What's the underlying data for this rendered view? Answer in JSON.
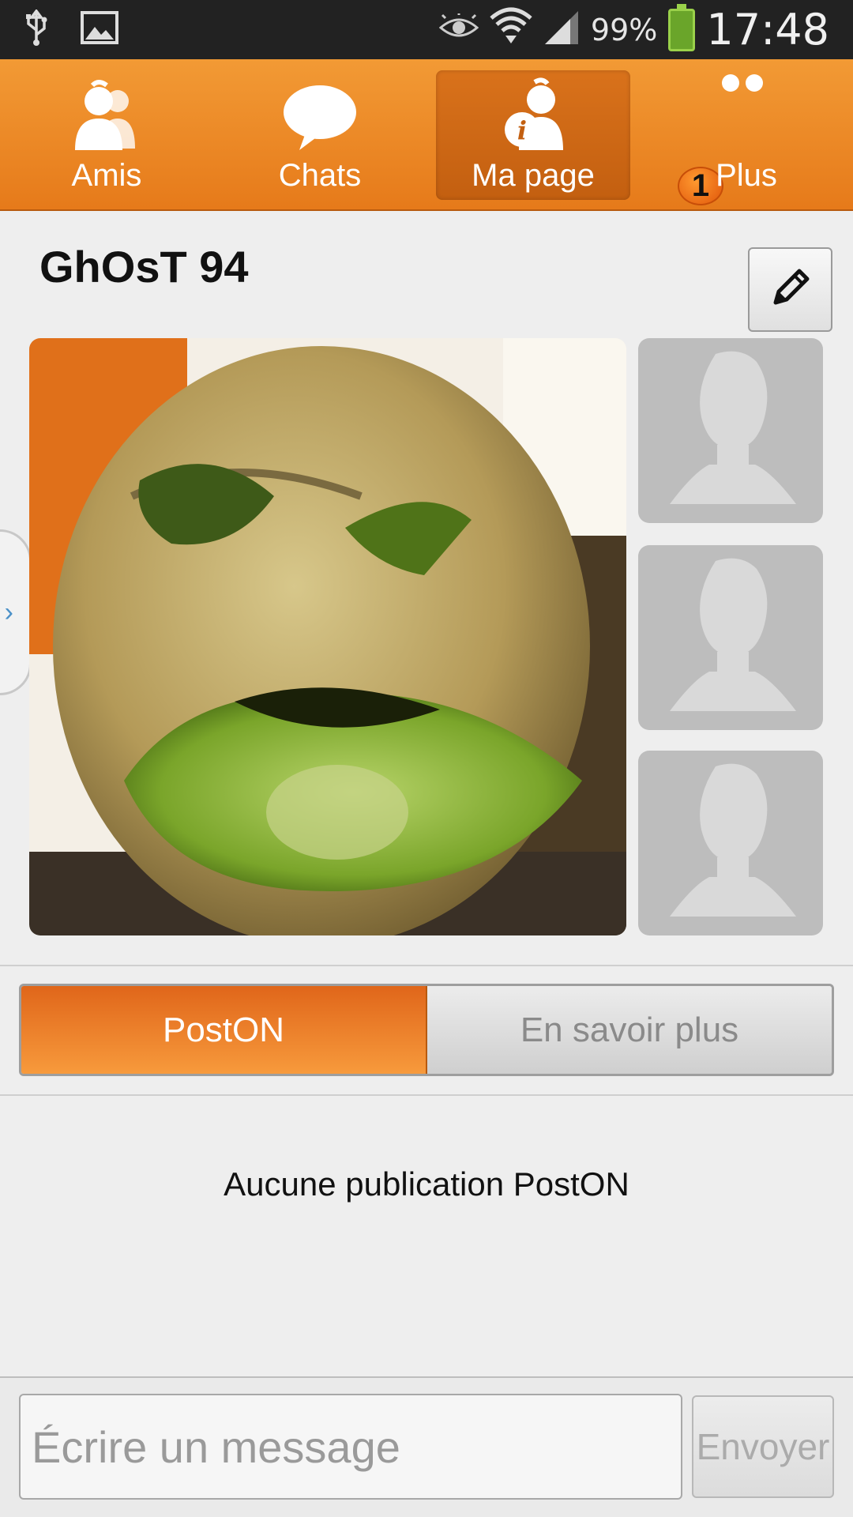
{
  "status_bar": {
    "battery": "99%",
    "time": "17:48",
    "icons": [
      "usb-icon",
      "image-icon",
      "eye-icon",
      "wifi-icon",
      "signal-icon",
      "battery-charging-icon"
    ]
  },
  "nav": {
    "items": [
      {
        "label": "Amis",
        "icon": "friends-icon",
        "active": false
      },
      {
        "label": "Chats",
        "icon": "chat-bubble-icon",
        "active": false
      },
      {
        "label": "Ma page",
        "icon": "profile-info-icon",
        "active": true
      },
      {
        "label": "Plus",
        "icon": "more-dots-icon",
        "active": false,
        "badge": "1"
      }
    ],
    "colors": {
      "bar": "#e67a1a",
      "active": "#c35f10",
      "badge": "#e0560a"
    }
  },
  "profile": {
    "name": "GhOsT 94",
    "edit_icon": "pencil-icon",
    "main_photo": "kiwi-face-photo",
    "thumbnails": [
      "placeholder-avatar-icon",
      "placeholder-avatar-icon",
      "placeholder-avatar-icon"
    ]
  },
  "tabs": {
    "items": [
      {
        "label": "PostON",
        "active": true
      },
      {
        "label": "En savoir plus",
        "active": false
      }
    ]
  },
  "feed": {
    "empty_message": "Aucune publication PostON"
  },
  "composer": {
    "placeholder": "Écrire un message",
    "send_label": "Envoyer"
  }
}
